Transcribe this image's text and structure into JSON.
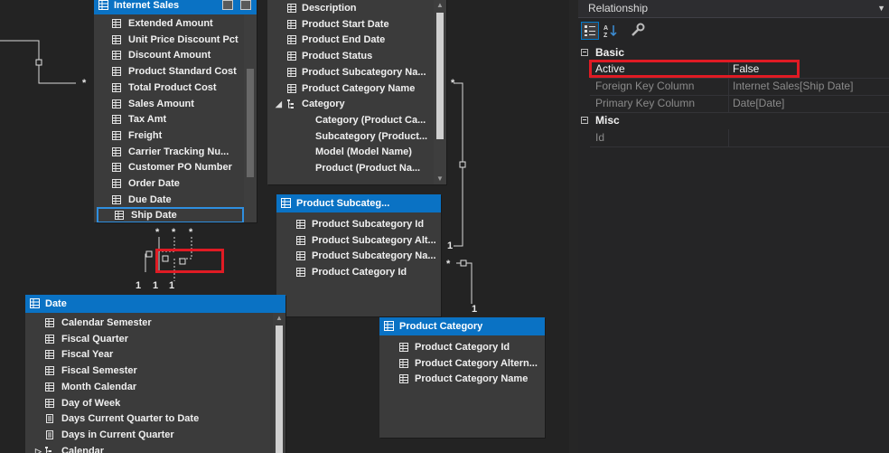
{
  "tables": {
    "internet_sales": {
      "title": "Internet Sales",
      "fields": [
        "Extended Amount",
        "Unit Price Discount Pct",
        "Discount Amount",
        "Product Standard Cost",
        "Total Product Cost",
        "Sales Amount",
        "Tax Amt",
        "Freight",
        "Carrier Tracking Nu...",
        "Customer PO Number",
        "Order Date",
        "Due Date",
        "Ship Date"
      ]
    },
    "product": {
      "fields": [
        "Description",
        "Product Start Date",
        "Product End Date",
        "Product Status",
        "Product Subcategory Na...",
        "Product Category Name"
      ],
      "hierarchy": {
        "label": "Category",
        "levels": [
          "Category (Product Ca...",
          "Subcategory (Product...",
          "Model (Model Name)",
          "Product  (Product Na..."
        ]
      }
    },
    "product_subcategory": {
      "title": "Product Subcateg...",
      "fields": [
        "Product Subcategory Id",
        "Product Subcategory Alt...",
        "Product Subcategory Na...",
        "Product Category Id"
      ]
    },
    "date": {
      "title": "Date",
      "fields": [
        "Calendar Semester",
        "Fiscal Quarter",
        "Fiscal Year",
        "Fiscal Semester",
        "Month Calendar",
        "Day of Week",
        "Days Current Quarter to Date",
        "Days in Current Quarter",
        "Calendar"
      ]
    },
    "product_category": {
      "title": "Product Category",
      "fields": [
        "Product Category Id",
        "Product Category Altern...",
        "Product Category Name"
      ]
    }
  },
  "cardinality": {
    "many": "*",
    "one": "1"
  },
  "properties": {
    "title": "Relationship",
    "categories": [
      {
        "name": "Basic",
        "rows": [
          {
            "name": "Active",
            "value": "False"
          },
          {
            "name": "Foreign Key Column",
            "value": "Internet Sales[Ship Date]"
          },
          {
            "name": "Primary Key Column",
            "value": "Date[Date]"
          }
        ]
      },
      {
        "name": "Misc",
        "rows": [
          {
            "name": "Id",
            "value": ""
          }
        ]
      }
    ]
  },
  "colors": {
    "header_blue": "#0a72c4",
    "highlight_red": "#e01b24",
    "canvas": "#232323",
    "table_bg": "#3b3b3b"
  },
  "icons": [
    "table-icon",
    "column-icon",
    "hierarchy-icon",
    "calculated-column-icon",
    "categorized-icon",
    "alphabetical-icon",
    "property-pages-icon"
  ]
}
